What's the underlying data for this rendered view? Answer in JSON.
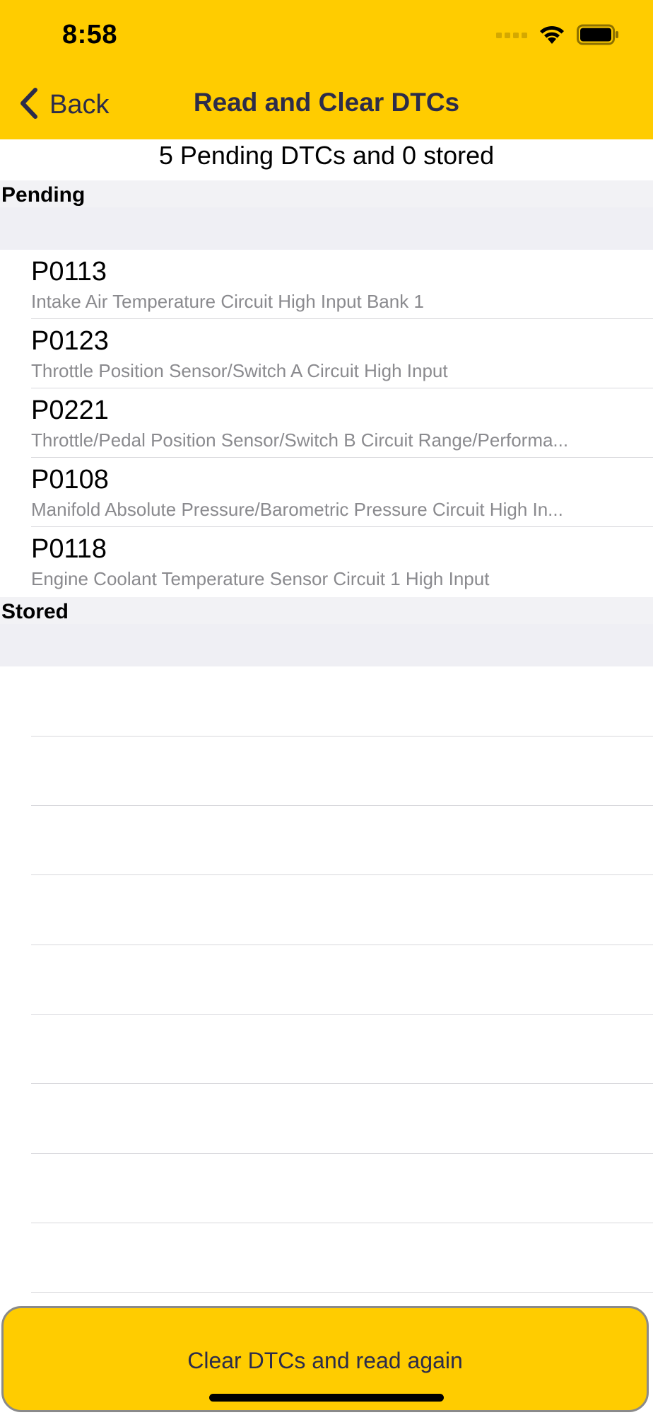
{
  "status_bar": {
    "time": "8:58"
  },
  "nav": {
    "back_label": "Back",
    "title": "Read and Clear DTCs"
  },
  "summary": "5 Pending DTCs and 0 stored",
  "sections": {
    "pending": {
      "label": "Pending",
      "items": [
        {
          "code": "P0113",
          "description": "Intake Air Temperature Circuit High Input Bank 1"
        },
        {
          "code": "P0123",
          "description": "Throttle Position Sensor/Switch A Circuit High Input"
        },
        {
          "code": "P0221",
          "description": "Throttle/Pedal Position Sensor/Switch B Circuit Range/Performa..."
        },
        {
          "code": "P0108",
          "description": "Manifold Absolute Pressure/Barometric Pressure Circuit High In..."
        },
        {
          "code": "P0118",
          "description": "Engine Coolant Temperature Sensor Circuit 1 High Input"
        }
      ]
    },
    "stored": {
      "label": "Stored",
      "items": []
    }
  },
  "clear_button_label": "Clear DTCs and read again",
  "colors": {
    "accent": "#ffcc00",
    "nav_text": "#2c2c4a",
    "secondary_text": "#8a8a8e",
    "section_bg": "#f2f2f5"
  },
  "icons": {
    "back": "chevron-left-icon",
    "signal": "cellular-signal-icon",
    "wifi": "wifi-icon",
    "battery": "battery-icon"
  }
}
